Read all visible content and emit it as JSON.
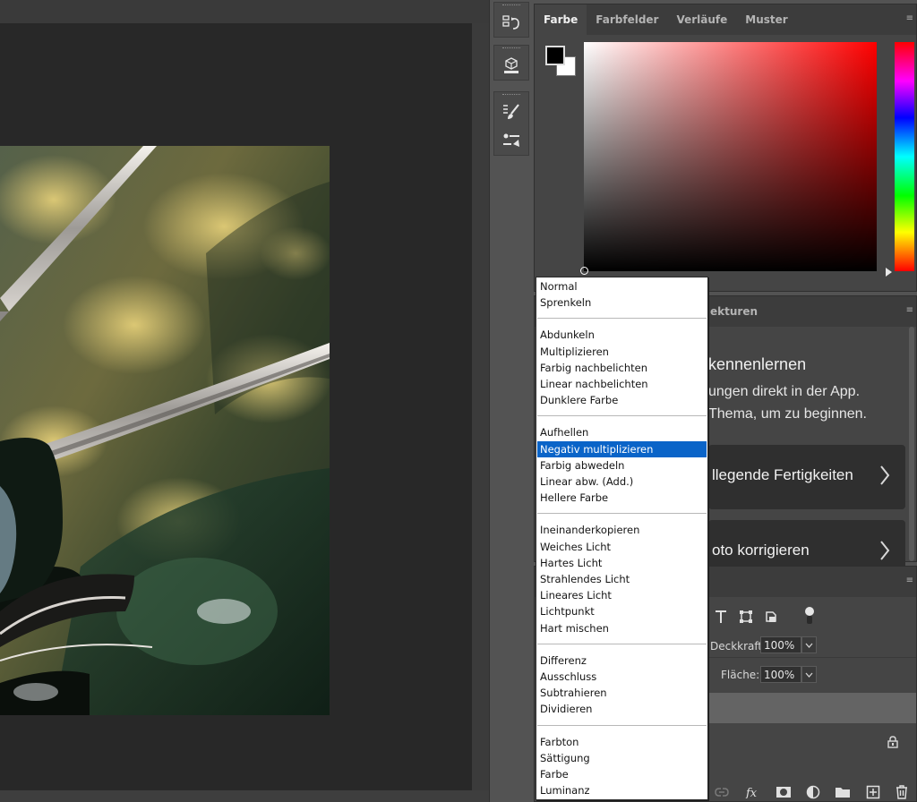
{
  "color_panel": {
    "tabs": [
      "Farbe",
      "Farbfelder",
      "Verläufe",
      "Muster"
    ],
    "active_tab": "Farbe",
    "foreground_color": "#000000",
    "background_color": "#ffffff",
    "hue_color": "#ff0000"
  },
  "learn_panel": {
    "tab_partial": "ekturen",
    "heading_partial": "kennenlernen",
    "body_line1": "ungen direkt in der App.",
    "body_line2": "Thema, um zu beginnen.",
    "cards": [
      "llegende Fertigkeiten",
      "oto korrigieren"
    ]
  },
  "layers_panel": {
    "opacity_label": "Deckkraft:",
    "opacity_value": "100%",
    "fill_label": "Fläche:",
    "fill_value": "100%"
  },
  "blend_modes": {
    "selected": "Negativ multiplizieren",
    "groups": [
      [
        "Normal",
        "Sprenkeln"
      ],
      [
        "Abdunkeln",
        "Multiplizieren",
        "Farbig nachbelichten",
        "Linear nachbelichten",
        "Dunklere Farbe"
      ],
      [
        "Aufhellen",
        "Negativ multiplizieren",
        "Farbig abwedeln",
        "Linear abw. (Add.)",
        "Hellere Farbe"
      ],
      [
        "Ineinanderkopieren",
        "Weiches Licht",
        "Hartes Licht",
        "Strahlendes Licht",
        "Lineares Licht",
        "Lichtpunkt",
        "Hart mischen"
      ],
      [
        "Differenz",
        "Ausschluss",
        "Subtrahieren",
        "Dividieren"
      ],
      [
        "Farbton",
        "Sättigung",
        "Farbe",
        "Luminanz"
      ]
    ]
  },
  "colors": {
    "selection_blue": "#0a64c8",
    "panel_bg": "#454545",
    "canvas_bg": "#282828"
  }
}
